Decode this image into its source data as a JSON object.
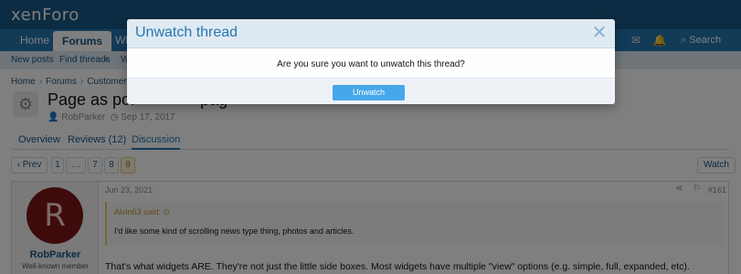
{
  "header": {
    "logo": "xenForo"
  },
  "nav": {
    "tabs": [
      "Home",
      "Forums",
      "Wh"
    ],
    "search_label": "Search"
  },
  "subnav": {
    "items": [
      "New posts",
      "Find threads",
      "W"
    ]
  },
  "breadcrumb": [
    "Home",
    "Forums",
    "Customer fo"
  ],
  "thread": {
    "title": "Page as por",
    "title_tail": "pag",
    "author": "RobParker",
    "date": "Sep 17, 2017"
  },
  "tabs": [
    "Overview",
    "Reviews (12)",
    "Discussion"
  ],
  "pager": {
    "prev": "‹ Prev",
    "pages": [
      "1",
      "…",
      "7",
      "8",
      "9"
    ]
  },
  "watch_label": "Watch",
  "post": {
    "avatar_letter": "R",
    "username": "RobParker",
    "user_title": "Well-known member",
    "date": "Jun 23, 2021",
    "number": "#161",
    "quote_author": "Alvin63 said:",
    "quote_text": "I'd like some kind of scrolling news type thing, photos and articles.",
    "body": "That's what widgets ARE. They're not just the little side boxes. Most widgets have multiple \"view\" options (e.g. simple, full, expanded, etc)."
  },
  "modal": {
    "title": "Unwatch thread",
    "message": "Are you sure you want to unwatch this thread?",
    "confirm_label": "Unwatch"
  },
  "colors": {
    "header": "#185886",
    "nav": "#2577b1",
    "accent": "#47a7eb",
    "modal_head": "#dfe9f1"
  },
  "icons": [
    "close-icon",
    "gear-icon",
    "search-icon",
    "envelope-icon",
    "bell-icon",
    "share-icon",
    "bookmark-icon",
    "user-icon",
    "clock-icon"
  ]
}
